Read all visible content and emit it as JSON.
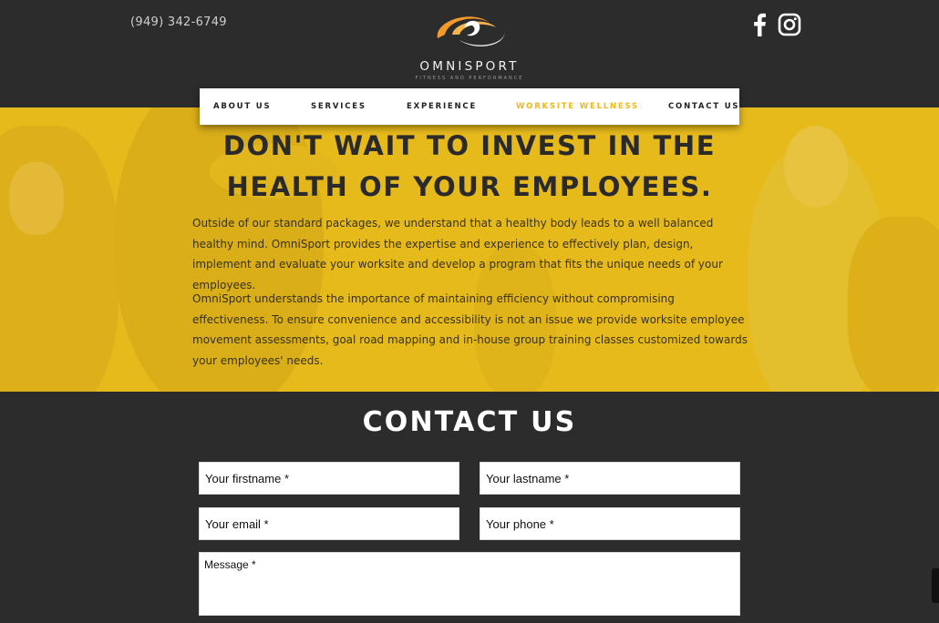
{
  "header": {
    "phone": "(949) 342-6749",
    "logo_name": "OMNISPORT",
    "logo_tagline": "FITNESS AND PERFORMANCE",
    "social": [
      {
        "name": "facebook",
        "icon": "facebook-icon"
      },
      {
        "name": "instagram",
        "icon": "instagram-icon"
      }
    ]
  },
  "nav": {
    "items": [
      {
        "label": "ABOUT US"
      },
      {
        "label": "SERVICES"
      },
      {
        "label": "EXPERIENCE"
      },
      {
        "label": "WORKSITE WELLNESS",
        "active": true
      },
      {
        "label": "CONTACT US"
      }
    ]
  },
  "hero": {
    "title_line1": "DON'T WAIT TO INVEST IN THE",
    "title_line2": "HEALTH OF YOUR EMPLOYEES.",
    "paragraph1": "Outside of our standard packages, we understand that a healthy body leads to a well balanced healthy mind. OmniSport provides the expertise and experience to effectively plan, design, implement and evaluate your worksite and develop a program that fits the unique needs of your employees.",
    "paragraph2": "OmniSport understands the importance of maintaining efficiency without compromising effectiveness. To ensure convenience and accessibility is not an issue we provide worksite employee movement assessments, goal road mapping and in-house group training classes customized towards your employees' needs."
  },
  "contact": {
    "title": "CONTACT US",
    "firstname_placeholder": "Your firstname *",
    "lastname_placeholder": "Your lastname *",
    "email_placeholder": "Your email *",
    "phone_placeholder": "Your phone *",
    "message_placeholder": "Message *"
  },
  "colors": {
    "background": "#2c2c2c",
    "accent": "#f0b916",
    "hero_overlay": "#e0b51b",
    "logo_orange": "#f39a2a"
  }
}
